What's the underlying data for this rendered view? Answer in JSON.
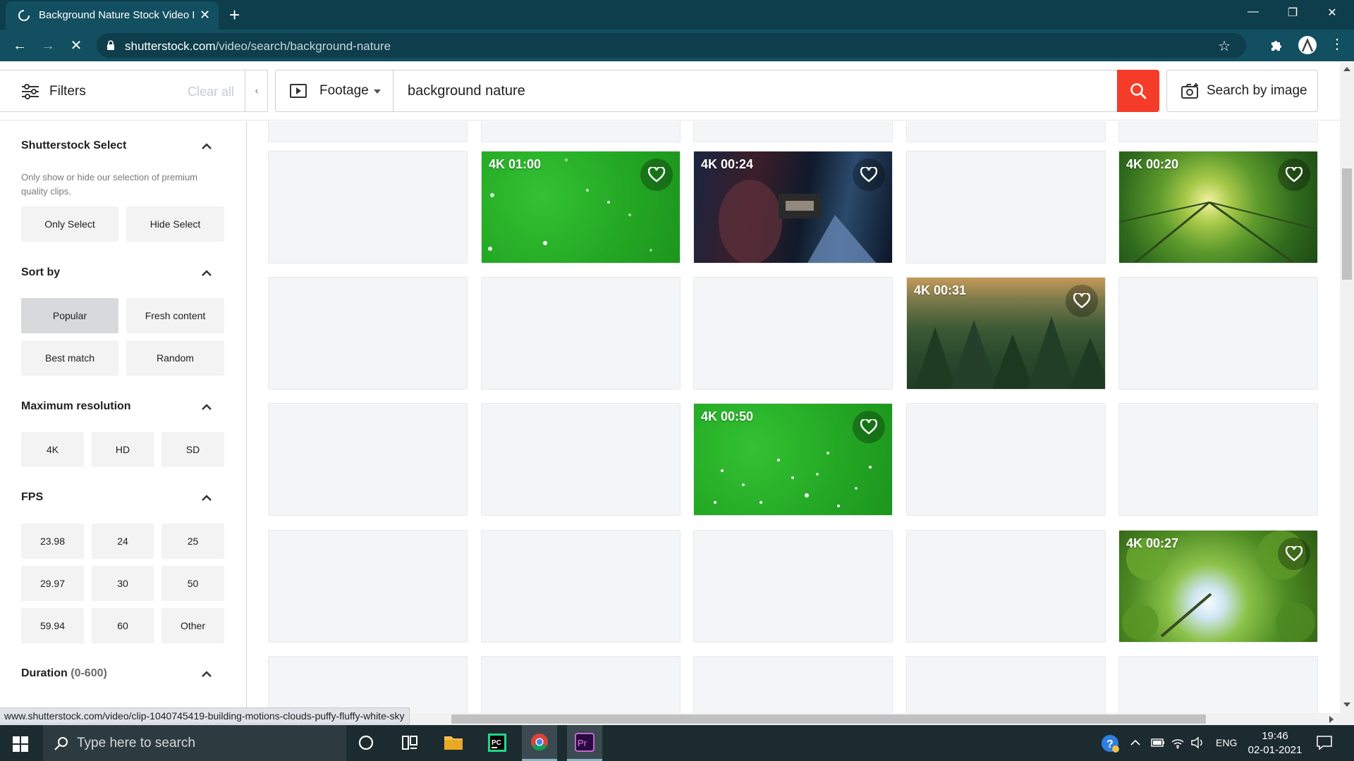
{
  "browser": {
    "tab_title": "Background Nature Stock Video F",
    "url_host": "shutterstock.com",
    "url_path": "/video/search/background-nature",
    "status_url": "www.shutterstock.com/video/clip-1040745419-building-motions-clouds-puffy-fluffy-white-sky"
  },
  "topbar": {
    "filters_label": "Filters",
    "clear_all": "Clear all",
    "media_type": "Footage",
    "search_value": "background nature",
    "search_by_image": "Search by image"
  },
  "sidebar": {
    "select": {
      "title": "Shutterstock Select",
      "desc": "Only show or hide our selection of premium quality clips.",
      "options": [
        "Only Select",
        "Hide Select"
      ]
    },
    "sort": {
      "title": "Sort by",
      "options": [
        "Popular",
        "Fresh content",
        "Best match",
        "Random"
      ],
      "selected": "Popular"
    },
    "resolution": {
      "title": "Maximum resolution",
      "options": [
        "4K",
        "HD",
        "SD"
      ]
    },
    "fps": {
      "title": "FPS",
      "options": [
        "23.98",
        "24",
        "25",
        "29.97",
        "30",
        "50",
        "59.94",
        "60",
        "Other"
      ]
    },
    "duration": {
      "title": "Duration",
      "range": "(0-600)"
    }
  },
  "results": {
    "clips": [
      {
        "badge": "4K 01:00",
        "thumb": "green-screen-particles"
      },
      {
        "badge": "4K 00:24",
        "thumb": "man-with-camera"
      },
      {
        "badge": "4K 00:20",
        "thumb": "forest-canopy-sunlight"
      },
      {
        "badge": "4K 00:31",
        "thumb": "aerial-pine-forest"
      },
      {
        "badge": "4K 00:50",
        "thumb": "green-screen-snow"
      },
      {
        "badge": "4K 00:27",
        "thumb": "tree-canopy-sky"
      }
    ]
  },
  "taskbar": {
    "search_placeholder": "Type here to search",
    "language": "ENG",
    "time": "19:46",
    "date": "02-01-2021"
  },
  "colors": {
    "chrome_dark": "#0e3d4b",
    "chrome_toolbar": "#124f60",
    "search_red": "#f53c28",
    "tile_empty": "#f4f5f6"
  }
}
